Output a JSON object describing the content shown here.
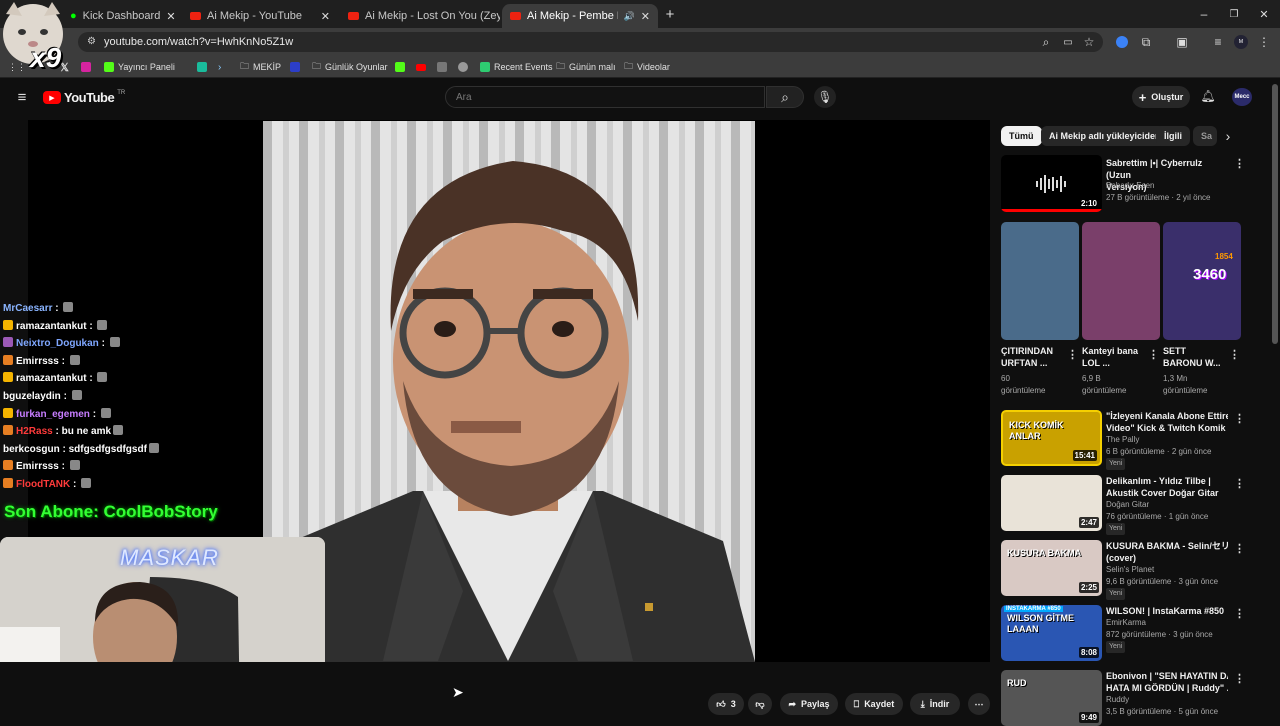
{
  "browser": {
    "tabs": [
      {
        "label": "Kick Dashboard",
        "has_yt": false
      },
      {
        "label": "Ai Mekip - YouTube",
        "has_yt": true
      },
      {
        "label": "Ai Mekip - Lost On You (Zeyn)",
        "has_yt": true
      },
      {
        "label": "Ai Mekip - Pembe Mezarlık",
        "has_yt": true
      }
    ],
    "url": "youtube.com/watch?v=HwhKnNo5Z1w",
    "bookmarks": {
      "yayinci": "Yayıncı Paneli",
      "mekip": "MEKİP",
      "gunluk": "Günlük Oyunlar",
      "recent": "Recent Events",
      "gunun": "Günün malı",
      "videolar": "Videolar"
    }
  },
  "youtube": {
    "logo_text": "YouTube",
    "logo_country": "TR",
    "search_placeholder": "Ara",
    "create_label": "Oluştur",
    "avatar_text": "Mecc"
  },
  "overlay": {
    "emote_count": "x9",
    "chat": [
      {
        "user": "MrCaesarr",
        "msg": "",
        "color": "#8ab4ff",
        "badge": ""
      },
      {
        "user": "ramazantankut",
        "msg": "",
        "color": "#ffffff",
        "badge": "#f4b400"
      },
      {
        "user": "Neixtro_Dogukan",
        "msg": "",
        "color": "#7fa7ff",
        "badge": "#9b59b6"
      },
      {
        "user": "Emirrsss",
        "msg": "",
        "color": "#ffffff",
        "badge": "#e67e22"
      },
      {
        "user": "ramazantankut",
        "msg": "",
        "color": "#ffffff",
        "badge": "#f4b400"
      },
      {
        "user": "bguzelaydin",
        "msg": "",
        "color": "#ffffff",
        "badge": ""
      },
      {
        "user": "furkan_egemen",
        "msg": "",
        "color": "#c77dff",
        "badge": "#f4b400"
      },
      {
        "user": "H2Rass",
        "msg": "bu ne amk",
        "color": "#ff3b3b",
        "badge": "#e67e22"
      },
      {
        "user": "berkcosgun",
        "msg": "sdfgsdfgsdfgsdf",
        "color": "#ffffff",
        "badge": ""
      },
      {
        "user": "Emirrsss",
        "msg": "",
        "color": "#ffffff",
        "badge": "#e67e22"
      },
      {
        "user": "FloodTANK",
        "msg": "",
        "color": "#ff3b3b",
        "badge": "#e67e22"
      }
    ],
    "sub_label": "Son Abone: CoolBobStory",
    "cam_logo": "MASKAR"
  },
  "actions": {
    "like_count": "3",
    "share": "Paylaş",
    "save": "Kaydet",
    "download": "İndir"
  },
  "chips": [
    "Tümü",
    "Ai Mekip adlı yükleyiciden",
    "İlgili",
    "Sa"
  ],
  "sidebar": {
    "first": {
      "title1": "Sabrettim |•| Cyberrulz (Uzun",
      "title2": "Versiyon)",
      "channel": "Bahadır Esen",
      "meta": "27 B görüntüleme · 2 yıl önce",
      "duration": "2:10"
    },
    "shorts": [
      {
        "t1": "ÇITIRINDAN",
        "t2": "URFTAN ...",
        "v": "60",
        "v2": "görüntüleme"
      },
      {
        "t1": "Kanteyi bana",
        "t2": "LOL ...",
        "v": "6,9 B",
        "v2": "görüntüleme"
      },
      {
        "t1": "SETT",
        "t2": "BARONU W...",
        "v": "1,3 Mn",
        "v2": "görüntüleme"
      }
    ],
    "shorts_overlays": {
      "a": "3460",
      "b": "1854"
    },
    "videos": [
      {
        "t1": "\"İzleyeni Kanala Abone Ettiren",
        "t2": "Video\" Kick & Twitch Komik ...",
        "ch": "The Pally",
        "meta": "6 B görüntüleme · 2 gün önce",
        "dur": "15:41",
        "badge": "Yeni",
        "thumbText": "KICK KOMİK ANLAR",
        "bg": "#c9a100"
      },
      {
        "t1": "Delikanlım - Yıldız Tilbe |",
        "t2": "Akustik Cover Doğar Gitar",
        "ch": "Doğan Gitar",
        "meta": "76 görüntüleme · 1 gün önce",
        "dur": "2:47",
        "badge": "Yeni",
        "thumbText": "",
        "bg": "#e9e3d8"
      },
      {
        "t1": "KUSURA BAKMA - Selin/セリン",
        "t2": "(cover)",
        "ch": "Selin's Planet",
        "meta": "9,6 B görüntüleme · 3 gün önce",
        "dur": "2:25",
        "badge": "Yeni",
        "thumbText": "KUSURA BAKMA",
        "bg": "#d9c9c4"
      },
      {
        "t1": "WILSON! | InstaKarma #850",
        "t2": "",
        "ch": "EmirKarma",
        "meta": "872 görüntüleme · 3 gün önce",
        "dur": "8:08",
        "badge": "Yeni",
        "thumbText": "WILSON GİTME LAAAN",
        "bg": "#2a56b3"
      },
      {
        "t1": "Ebonivon | \"SEN HAYATIN DA",
        "t2": "HATA MI GÖRDÜN | Ruddy\" ...",
        "ch": "Ruddy",
        "meta": "3,5 B görüntüleme · 5 gün önce",
        "dur": "9:49",
        "badge": "",
        "thumbText": "RUD",
        "bg": "#555"
      }
    ],
    "instakarma_tag": "INSTAKARMA #850"
  }
}
